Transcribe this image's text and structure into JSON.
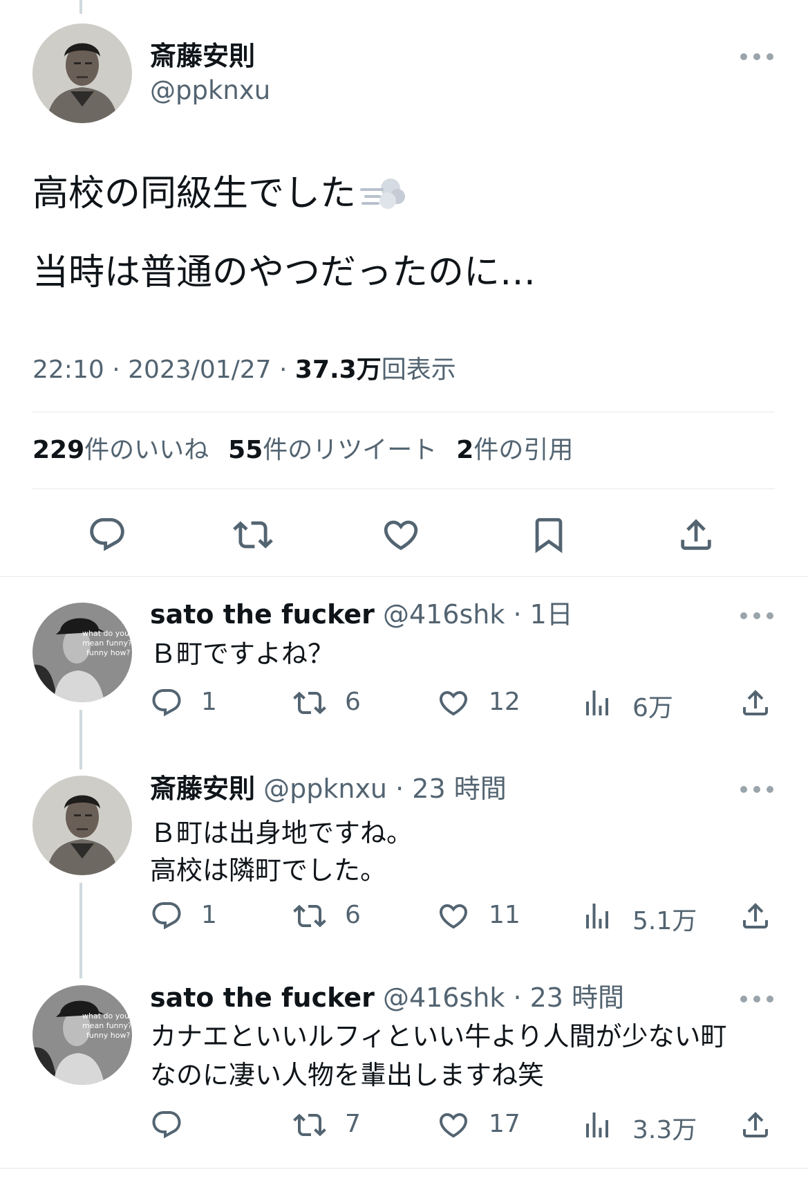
{
  "main_tweet": {
    "author_name": "斎藤安則",
    "author_handle": "@ppknxu",
    "text_line1": "高校の同級生でした",
    "text_line2": "当時は普通のやつだったのに…",
    "time": "22:10 · 2023/01/27 · ",
    "views_count": "37.3万",
    "views_label": "回表示",
    "likes_count": "229",
    "likes_label": "件のいいね",
    "retweets_count": "55",
    "retweets_label": "件のリツイート",
    "quotes_count": "2",
    "quotes_label": "件の引用"
  },
  "avatar_captions": {
    "sato": [
      "what do you",
      "mean funny?",
      "funny how?"
    ]
  },
  "replies": [
    {
      "name": "sato the fucker",
      "handle": "@416shk",
      "time": "· 1日",
      "lines": [
        "Ｂ町ですよね？"
      ],
      "replies": "1",
      "retweets": "6",
      "likes": "12",
      "views": "6万"
    },
    {
      "name": "斎藤安則",
      "handle": "@ppknxu",
      "time": "· 23 時間",
      "lines": [
        "Ｂ町は出身地ですね。",
        "高校は隣町でした。"
      ],
      "replies": "1",
      "retweets": "6",
      "likes": "11",
      "views": "5.1万"
    },
    {
      "name": "sato the fucker",
      "handle": "@416shk",
      "time": "· 23 時間",
      "lines": [
        "カナエといいルフィといい牛より人間が少ない町",
        "なのに凄い人物を輩出しますね笑"
      ],
      "replies": "",
      "retweets": "7",
      "likes": "17",
      "views": "3.3万"
    }
  ],
  "icons": [
    "more-icon",
    "reply-icon",
    "retweet-icon",
    "like-icon",
    "bookmark-icon",
    "share-icon",
    "views-icon",
    "dash-emoji-icon"
  ],
  "colors": {
    "text": "#0f1419",
    "secondary": "#536471",
    "divider": "#e6e9eb",
    "thread_line": "#cfd9de"
  }
}
